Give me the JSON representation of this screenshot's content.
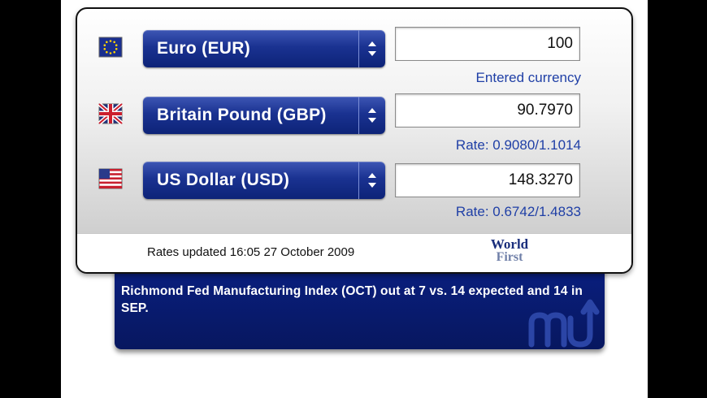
{
  "converter": {
    "rows": [
      {
        "flag": "eu-flag-icon",
        "currency": "Euro (EUR)",
        "amount": "100",
        "note": "Entered currency"
      },
      {
        "flag": "uk-flag-icon",
        "currency": "Britain Pound (GBP)",
        "amount": "90.7970",
        "note": "Rate: 0.9080/1.1014"
      },
      {
        "flag": "us-flag-icon",
        "currency": "US Dollar (USD)",
        "amount": "148.3270",
        "note": "Rate: 0.6742/1.4833"
      }
    ],
    "status": "Rates updated 16:05 27 October 2009",
    "brand_line1": "World",
    "brand_line2": "First"
  },
  "ticker": {
    "text": "Richmond Fed Manufacturing Index (OCT) out at 7 vs. 14 expected and 14 in SEP."
  },
  "colors": {
    "select_blue": "#1a3291",
    "note_blue": "#1f3fa6",
    "ticker_blue": "#0a1f80"
  }
}
